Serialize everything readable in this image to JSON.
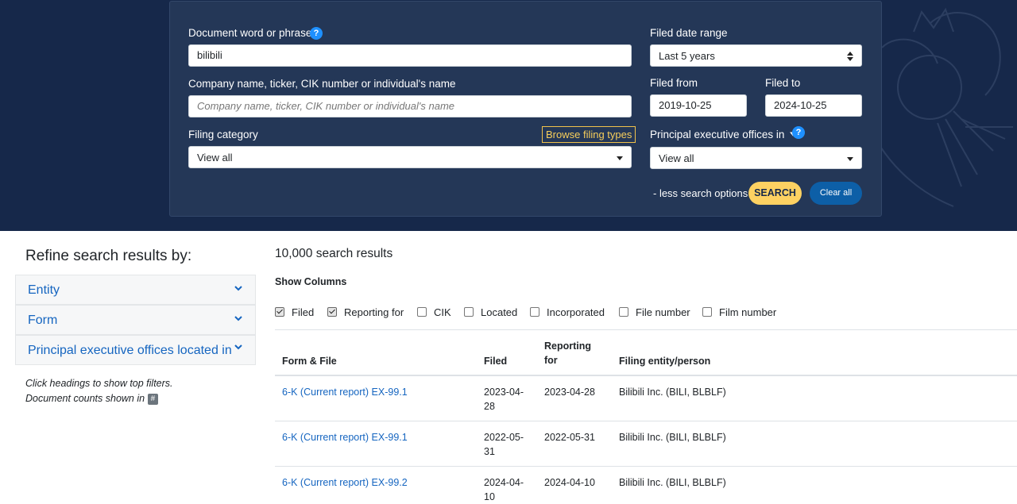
{
  "search": {
    "doc_label": "Document word or phrase",
    "doc_value": "bilibili",
    "company_label": "Company name, ticker, CIK number or individual's name",
    "company_placeholder": "Company name, ticker, CIK number or individual's name",
    "category_label": "Filing category",
    "category_value": "View all",
    "browse_label": "Browse filing types",
    "date_range_label": "Filed date range",
    "date_range_value": "Last 5 years",
    "from_label": "Filed from",
    "from_value": "2019-10-25",
    "to_label": "Filed to",
    "to_value": "2024-10-25",
    "offices_label": "Principal executive offices in",
    "offices_value": "View all",
    "less_options": "- less search options",
    "search_label": "SEARCH",
    "clear_label": "Clear all",
    "help_glyph": "?"
  },
  "sidebar": {
    "title": "Refine search results by:",
    "sections": [
      "Entity",
      "Form",
      "Principal executive offices located in"
    ],
    "hint_line1": "Click headings to show top filters.",
    "hint_line2": "Document counts shown in",
    "hint_badge": "#"
  },
  "results": {
    "count": "10,000 search results",
    "show_columns": "Show Columns",
    "column_toggles": [
      {
        "label": "Filed",
        "checked": true
      },
      {
        "label": "Reporting for",
        "checked": true
      },
      {
        "label": "CIK",
        "checked": false
      },
      {
        "label": "Located",
        "checked": false
      },
      {
        "label": "Incorporated",
        "checked": false
      },
      {
        "label": "File number",
        "checked": false
      },
      {
        "label": "Film number",
        "checked": false
      }
    ],
    "headers": {
      "form": "Form & File",
      "filed": "Filed",
      "reporting_1": "Reporting",
      "reporting_2": "for",
      "entity": "Filing entity/person"
    },
    "rows": [
      {
        "form": "6-K (Current report) EX-99.1",
        "filed_1": "2023-04-",
        "filed_2": "28",
        "reporting": "2023-04-28",
        "entity": "Bilibili Inc. (BILI, BLBLF)"
      },
      {
        "form": "6-K (Current report) EX-99.1",
        "filed_1": "2022-05-",
        "filed_2": "31",
        "reporting": "2022-05-31",
        "entity": "Bilibili Inc. (BILI, BLBLF)"
      },
      {
        "form": "6-K (Current report) EX-99.2",
        "filed_1": "2024-04-",
        "filed_2": "10",
        "reporting": "2024-04-10",
        "entity": "Bilibili Inc. (BILI, BLBLF)"
      }
    ]
  },
  "colors": {
    "hero_bg": "#16284a",
    "panel_bg": "#243757",
    "link": "#1565c0",
    "search_btn": "#fdd162",
    "clear_btn": "#0d5fa7",
    "help_icon": "#1e90ff"
  }
}
